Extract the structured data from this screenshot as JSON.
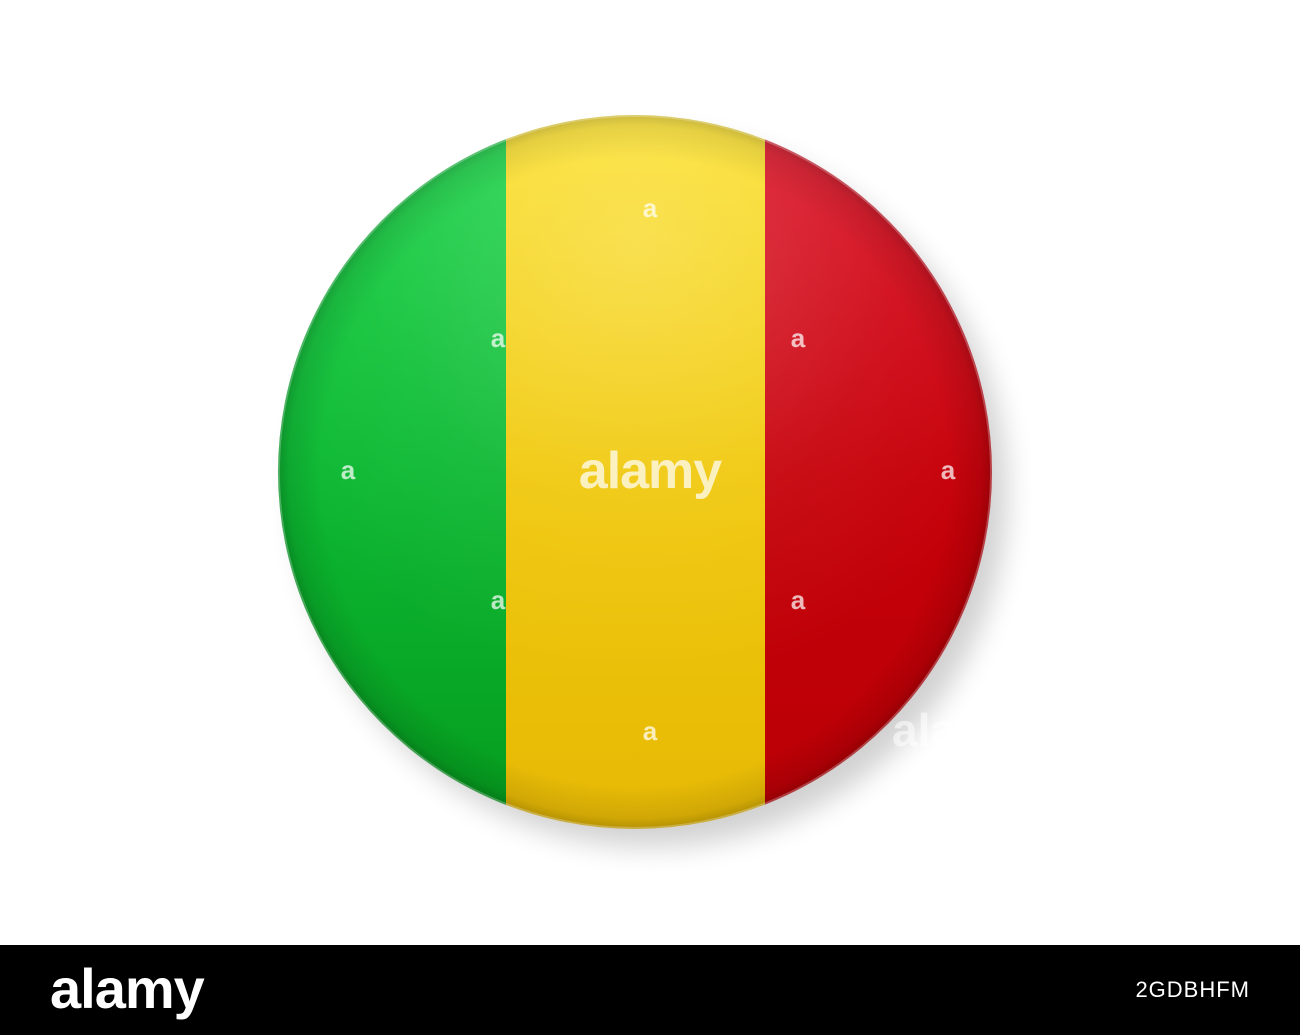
{
  "image": {
    "subject": "mali-flag-badge",
    "colors": {
      "green": "#0cb832",
      "yellow": "#f2cc0a",
      "red": "#c90009",
      "background": "#ffffff",
      "footer": "#000000"
    }
  },
  "watermark": {
    "small_mark": "a",
    "center_mark": "alamy",
    "edge_mark": "alamy"
  },
  "footer": {
    "logo": "alamy",
    "image_id": "2GDBHFM"
  }
}
